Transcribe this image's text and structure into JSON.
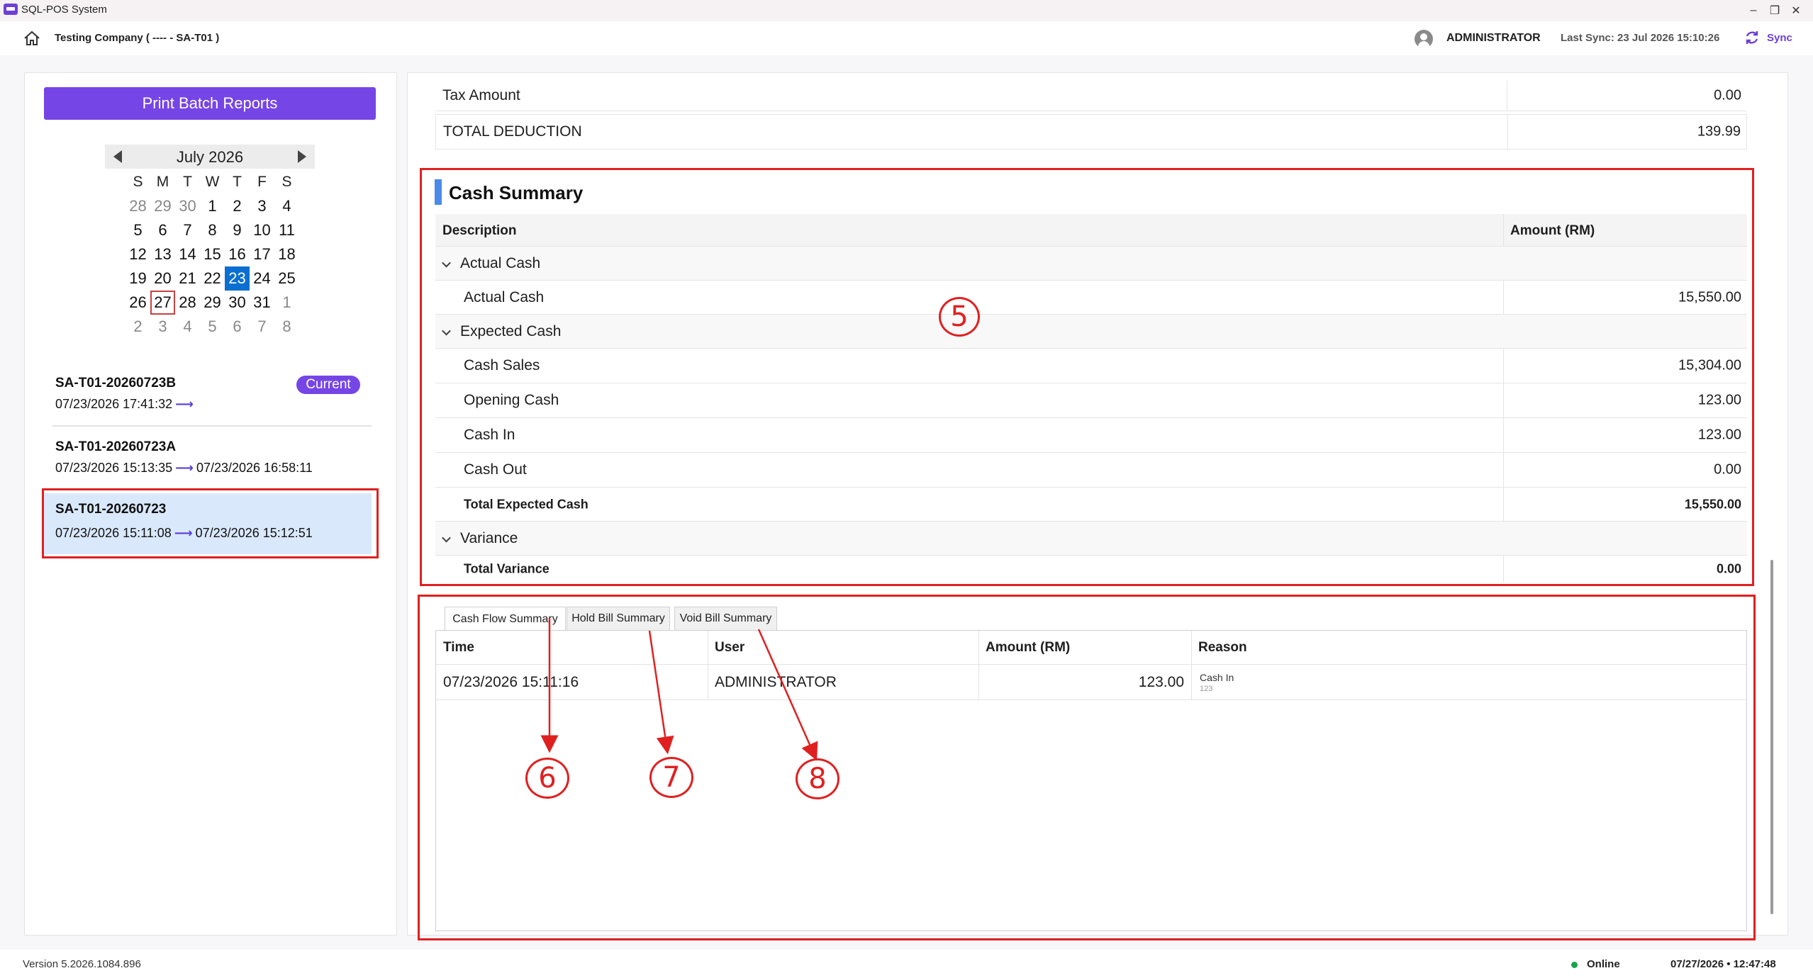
{
  "window": {
    "title": "SQL-POS System",
    "minimize": "–",
    "maximize": "❐",
    "close": "✕"
  },
  "header": {
    "company": "Testing Company ( ---- - SA-T01 )",
    "user": "ADMINISTRATOR",
    "last_sync": "Last Sync: 23 Jul 2026 15:10:26",
    "sync_label": "Sync"
  },
  "sidebar": {
    "print_button": "Print Batch Reports",
    "calendar": {
      "month": "July 2026",
      "days_of_week": [
        "S",
        "M",
        "T",
        "W",
        "T",
        "F",
        "S"
      ],
      "weeks": [
        [
          "28",
          "29",
          "30",
          "1",
          "2",
          "3",
          "4"
        ],
        [
          "5",
          "6",
          "7",
          "8",
          "9",
          "10",
          "11"
        ],
        [
          "12",
          "13",
          "14",
          "15",
          "16",
          "17",
          "18"
        ],
        [
          "19",
          "20",
          "21",
          "22",
          "23",
          "24",
          "25"
        ],
        [
          "26",
          "27",
          "28",
          "29",
          "30",
          "31",
          "1"
        ],
        [
          "2",
          "3",
          "4",
          "5",
          "6",
          "7",
          "8"
        ]
      ],
      "selected": "23",
      "today": "27"
    },
    "batches": [
      {
        "id": "SA-T01-20260723B",
        "start": "07/23/2026 17:41:32",
        "end": "",
        "badge": "Current"
      },
      {
        "id": "SA-T01-20260723A",
        "start": "07/23/2026 15:13:35",
        "end": "07/23/2026 16:58:11"
      },
      {
        "id": "SA-T01-20260723",
        "start": "07/23/2026 15:11:08",
        "end": "07/23/2026 15:12:51"
      }
    ]
  },
  "deductions": {
    "tax_label": "Tax Amount",
    "tax_value": "0.00",
    "total_label": "TOTAL DEDUCTION",
    "total_value": "139.99"
  },
  "cash_summary": {
    "title": "Cash Summary",
    "col_description": "Description",
    "col_amount": "Amount (RM)",
    "actual_group": "Actual Cash",
    "actual_cash_label": "Actual Cash",
    "actual_cash_value": "15,550.00",
    "expected_group": "Expected Cash",
    "cash_sales_label": "Cash Sales",
    "cash_sales_value": "15,304.00",
    "opening_cash_label": "Opening Cash",
    "opening_cash_value": "123.00",
    "cash_in_label": "Cash In",
    "cash_in_value": "123.00",
    "cash_out_label": "Cash Out",
    "cash_out_value": "0.00",
    "total_expected_label": "Total Expected Cash",
    "total_expected_value": "15,550.00",
    "variance_group": "Variance",
    "total_variance_label": "Total Variance",
    "total_variance_value": "0.00"
  },
  "tabs": {
    "cash_flow": "Cash Flow Summary",
    "hold_bill": "Hold Bill Summary",
    "void_bill": "Void Bill Summary"
  },
  "cash_flow_table": {
    "col_time": "Time",
    "col_user": "User",
    "col_amount": "Amount (RM)",
    "col_reason": "Reason",
    "rows": [
      {
        "time": "07/23/2026 15:11:16",
        "user": "ADMINISTRATOR",
        "amount": "123.00",
        "reason": "Cash In",
        "reason_note": "123"
      }
    ]
  },
  "annotations": {
    "five": "5",
    "six": "6",
    "seven": "7",
    "eight": "8"
  },
  "footer": {
    "version": "Version 5.2026.1084.896",
    "status": "Online",
    "datetime": "07/27/2026 • 12:47:48"
  }
}
